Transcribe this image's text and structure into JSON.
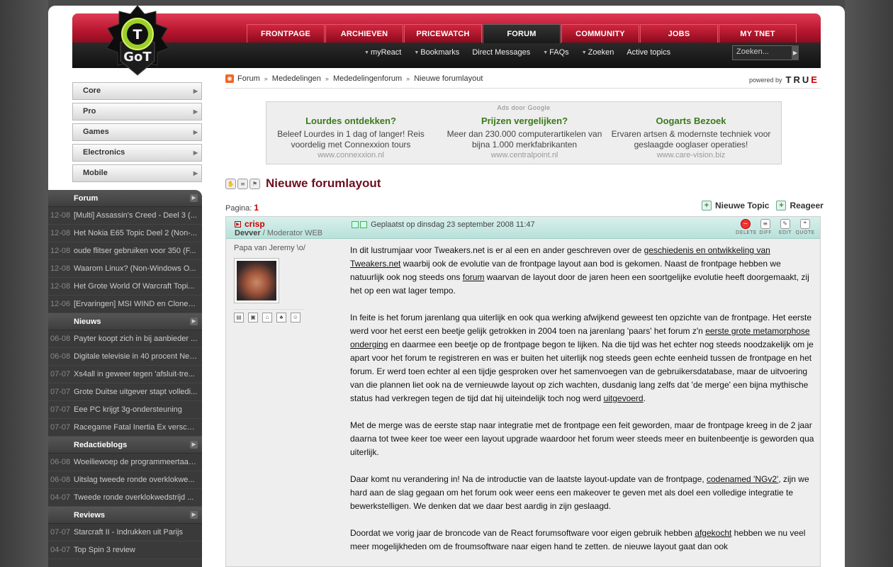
{
  "logo": {
    "text": "GoT",
    "mark": "T"
  },
  "tabs": [
    "FRONTPAGE",
    "ARCHIEVEN",
    "PRICEWATCH",
    "FORUM",
    "COMMUNITY",
    "JOBS",
    "MY TNET"
  ],
  "subnav": {
    "myreact": "myReact",
    "bookmarks": "Bookmarks",
    "dm": "Direct Messages",
    "faqs": "FAQs",
    "zoeken": "Zoeken",
    "active": "Active topics"
  },
  "search": {
    "placeholder": "Zoeken..."
  },
  "categories": [
    "Core",
    "Pro",
    "Games",
    "Electronics",
    "Mobile"
  ],
  "sidebar": {
    "forum": {
      "title": "Forum",
      "items": [
        {
          "date": "12-08",
          "text": "[Multi] Assassin's Creed - Deel 3 (..."
        },
        {
          "date": "12-08",
          "text": "Het Nokia E65 Topic Deel 2 (Non-..."
        },
        {
          "date": "12-08",
          "text": "oude flitser gebruiken voor 350 (F..."
        },
        {
          "date": "12-08",
          "text": "Waarom Linux? (Non-Windows O..."
        },
        {
          "date": "12-08",
          "text": "Het Grote World Of Warcraft Topi..."
        },
        {
          "date": "12-06",
          "text": "[Ervaringen] MSI WIND en Clones ..."
        }
      ]
    },
    "nieuws": {
      "title": "Nieuws",
      "items": [
        {
          "date": "06-08",
          "text": "Payter koopt zich in bij aanbieder ..."
        },
        {
          "date": "06-08",
          "text": "Digitale televisie in 40 procent Ned..."
        },
        {
          "date": "07-07",
          "text": "Xs4all in geweer tegen 'afsluit-tre..."
        },
        {
          "date": "07-07",
          "text": "Grote Duitse uitgever stapt volledi..."
        },
        {
          "date": "07-07",
          "text": "Eee PC krijgt 3g-ondersteuning"
        },
        {
          "date": "07-07",
          "text": "Racegame Fatal Inertia Ex verschi..."
        }
      ]
    },
    "blogs": {
      "title": "Redactieblogs",
      "items": [
        {
          "date": "06-08",
          "text": "Woeiliewoep de programmeertaal ..."
        },
        {
          "date": "06-08",
          "text": "Uitslag tweede ronde overklokwe..."
        },
        {
          "date": "04-07",
          "text": "Tweede ronde overklokwedstrijd ..."
        }
      ]
    },
    "reviews": {
      "title": "Reviews",
      "items": [
        {
          "date": "07-07",
          "text": "Starcraft II - Indrukken uit Parijs"
        },
        {
          "date": "04-07",
          "text": "Top Spin 3 review"
        }
      ]
    }
  },
  "breadcrumb": [
    "Forum",
    "Mededelingen",
    "Mededelingenforum",
    "Nieuwe forumlayout"
  ],
  "powered": {
    "label": "powered by",
    "brand_a": "TRU",
    "brand_b": "E"
  },
  "ads": {
    "header": "Ads door Google",
    "items": [
      {
        "title": "Lourdes ontdekken?",
        "body": "Beleef Lourdes in 1 dag of langer! Reis voordelig met Connexxion tours",
        "url": "www.connexxion.nl"
      },
      {
        "title": "Prijzen vergelijken?",
        "body": "Meer dan 230.000 computerartikelen van bijna 1.000 merkfabrikanten",
        "url": "www.centralpoint.nl"
      },
      {
        "title": "Oogarts Bezoek",
        "body": "Ervaren artsen & modernste techniek voor geslaagde ooglaser operaties!",
        "url": "www.care-vision.biz"
      }
    ]
  },
  "topic": {
    "title": "Nieuwe forumlayout",
    "pagina_label": "Pagina:",
    "page": "1",
    "new_topic": "Nieuwe Topic",
    "reply": "Reageer"
  },
  "post": {
    "user": "crisp",
    "rank": "Devver",
    "role": "/ Moderator WEB",
    "subtitle": "Papa van Jeremy \\o/",
    "posted": "Geplaatst op dinsdag 23 september 2008 11:47",
    "tools": [
      "DELETE",
      "DIFF",
      "EDIT",
      "QUOTE"
    ],
    "p1a": "In dit lustrumjaar voor Tweakers.net is er al een en ander geschreven over de ",
    "p1l1": "geschiedenis en ontwikkeling van Tweakers.net",
    "p1b": " waarbij ook de evolutie van de frontpage layout aan bod is gekomen. Naast de frontpage hebben we natuurlijk ook nog steeds ons ",
    "p1l2": "forum",
    "p1c": " waarvan de layout door de jaren heen een soortgelijke evolutie heeft doorgemaakt, zij het op een wat lager tempo.",
    "p2a": "In feite is het forum jarenlang qua uiterlijk en ook qua werking afwijkend geweest ten opzichte van de frontpage. Het eerste werd voor het eerst een beetje gelijk getrokken in 2004 toen na jarenlang 'paars' het forum z'n ",
    "p2l1": "eerste grote metamorphose onderging",
    "p2b": " en daarmee een beetje op de frontpage begon te lijken. Na die tijd was het echter nog steeds noodzakelijk om je apart voor het forum te registreren en was er buiten het uiterlijk nog steeds geen echte eenheid tussen de frontpage en het forum. Er werd toen echter al een tijdje gesproken over het samenvoegen van de gebruikersdatabase, maar de uitvoering van die plannen liet ook na de vernieuwde layout op zich wachten, dusdanig lang zelfs dat 'de merge' een bijna mythische status had verkregen tegen de tijd dat hij uiteindelijk toch nog werd ",
    "p2l2": "uitgevoerd",
    "p2c": ".",
    "p3": "Met de merge was de eerste stap naar integratie met de frontpage een feit geworden, maar de frontpage kreeg in de 2 jaar daarna tot twee keer toe weer een layout upgrade waardoor het forum weer steeds meer en buitenbeentje is geworden qua uiterlijk.",
    "p4a": "Daar komt nu verandering in! Na de introductie van de laatste layout-update van de frontpage, ",
    "p4l": "codenamed 'NGv2'",
    "p4b": ", zijn we hard aan de slag gegaan om het forum ook weer eens een makeover te geven met als doel een volledige integratie te bewerkstelligen. We denken dat we daar best aardig in zijn geslaagd.",
    "p5a": "Doordat we vorig jaar de broncode van de React forumsoftware voor eigen gebruik hebben ",
    "p5l": "afgekocht",
    "p5b": " hebben we nu veel meer mogelijkheden om de froumsoftware naar eigen hand te zetten. de nieuwe layout gaat dan ook"
  }
}
